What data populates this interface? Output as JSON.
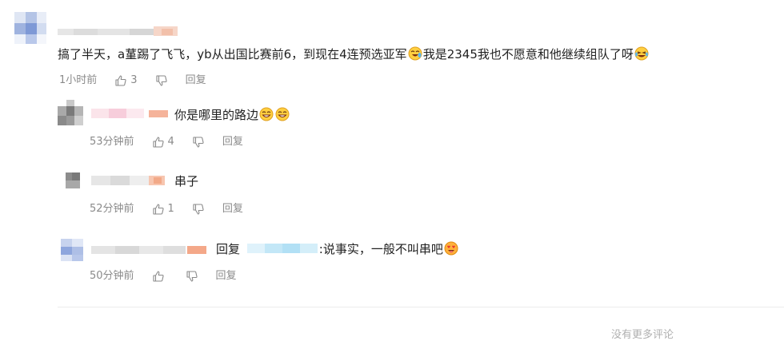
{
  "comments": [
    {
      "text": "搞了半天，a蓳踢了飞飞，yb从出国比赛前6，到现在4连预选亚军",
      "text_tail": "我是2345我也不愿意和他继续组队了呀",
      "time": "1小时前",
      "likes": "3",
      "reply_label": "回复"
    }
  ],
  "replies": [
    {
      "text": "你是哪里的路边",
      "time": "53分钟前",
      "likes": "4",
      "reply_label": "回复"
    },
    {
      "text": "串子",
      "time": "52分钟前",
      "likes": "1",
      "reply_label": "回复"
    },
    {
      "prefix": "回复",
      "text": ":说事实，一般不叫串吧",
      "time": "50分钟前",
      "likes": "",
      "reply_label": "回复"
    }
  ],
  "footer_text": "没有更多评论",
  "icons": {
    "like": "thumbs-up-icon",
    "dislike": "thumbs-down-icon",
    "emoji_tear": "crying-laugh-emoji-icon",
    "emoji_joy": "laughing-tears-emoji-icon",
    "emoji_smile": "grinning-emoji-icon",
    "emoji_heart": "heart-eyes-emoji-icon"
  }
}
